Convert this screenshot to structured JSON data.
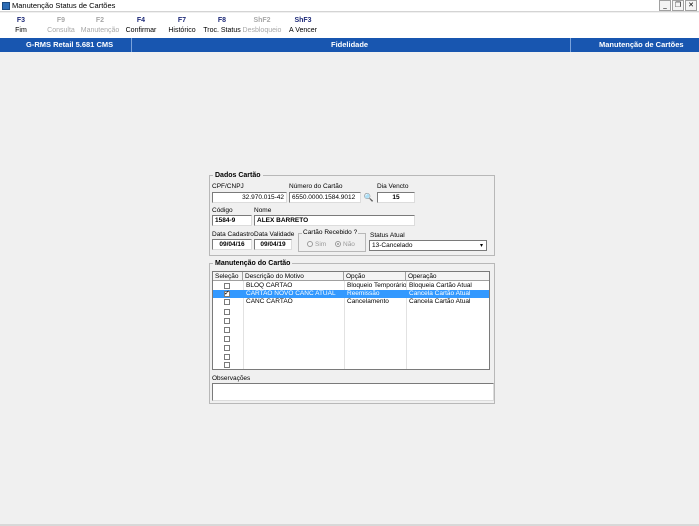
{
  "window": {
    "title": "Manutenção Status de Cartões",
    "minimize": "_",
    "restore": "❐",
    "close": "✕"
  },
  "toolbar": [
    {
      "key": "F3",
      "label": "Fim",
      "enabled": true
    },
    {
      "key": "F9",
      "label": "Consulta",
      "enabled": false
    },
    {
      "key": "F2",
      "label": "Manutenção",
      "enabled": false
    },
    {
      "key": "F4",
      "label": "Confirmar",
      "enabled": true
    },
    {
      "key": "F7",
      "label": "Histórico",
      "enabled": true
    },
    {
      "key": "F8",
      "label": "Troc. Status",
      "enabled": true
    },
    {
      "key": "ShF2",
      "label": "Desbloqueio",
      "enabled": false
    },
    {
      "key": "ShF3",
      "label": "A Vencer",
      "enabled": true
    }
  ],
  "header": {
    "system": "G-RMS Retail 5.681 CMS",
    "module": "Fidelidade",
    "screen": "Manutenção de Cartões"
  },
  "dados_cartao": {
    "title": "Dados Cartão",
    "cpf_label": "CPF/CNPJ",
    "cpf_value": "32.970.015-42",
    "numero_label": "Número do Cartão",
    "numero_value": "6550.0000.1584.9012",
    "binoculars_icon": "🔍",
    "dia_vencto_label": "Dia Vencto",
    "dia_vencto_value": "15",
    "codigo_label": "Código",
    "codigo_value": "1584-9",
    "nome_label": "Nome",
    "nome_value": "ALEX BARRETO",
    "data_cadastro_label": "Data Cadastro",
    "data_cadastro_value": "09/04/16",
    "data_validade_label": "Data Validade",
    "data_validade_value": "09/04/19",
    "cartao_recebido_label": "Cartão Recebido ?",
    "radio_sim": "Sim",
    "radio_nao": "Não",
    "status_label": "Status Atual",
    "status_value": "13-Cancelado",
    "dropdown_arrow": "▾"
  },
  "manutencao": {
    "title": "Manutenção do Cartão",
    "columns": [
      "Seleção",
      "Descrição do Motivo",
      "Opção",
      "Operação"
    ],
    "rows": [
      {
        "checked": false,
        "motivo": "BLOQ CARTAO",
        "opcao": "Bloqueio Temporário",
        "operacao": "Bloqueia Cartão Atual",
        "selected": false
      },
      {
        "checked": true,
        "motivo": "CARTAO NOVO CANC ATUAL",
        "opcao": "Reemissão",
        "operacao": "Cancela Cartão Atual",
        "selected": true
      },
      {
        "checked": false,
        "motivo": "CANC CARTAO",
        "opcao": "Cancelamento",
        "operacao": "Cancela Cartão Atual",
        "selected": false
      },
      {
        "checked": false,
        "motivo": "",
        "opcao": "",
        "operacao": "",
        "selected": false
      },
      {
        "checked": false,
        "motivo": "",
        "opcao": "",
        "operacao": "",
        "selected": false
      },
      {
        "checked": false,
        "motivo": "",
        "opcao": "",
        "operacao": "",
        "selected": false
      },
      {
        "checked": false,
        "motivo": "",
        "opcao": "",
        "operacao": "",
        "selected": false
      },
      {
        "checked": false,
        "motivo": "",
        "opcao": "",
        "operacao": "",
        "selected": false
      },
      {
        "checked": false,
        "motivo": "",
        "opcao": "",
        "operacao": "",
        "selected": false
      },
      {
        "checked": false,
        "motivo": "",
        "opcao": "",
        "operacao": "",
        "selected": false
      }
    ],
    "observacoes_label": "Observações"
  },
  "colors": {
    "header_blue": "#1856b0",
    "selection_blue": "#3399ff",
    "toolbar_key": "#1e2a78"
  }
}
